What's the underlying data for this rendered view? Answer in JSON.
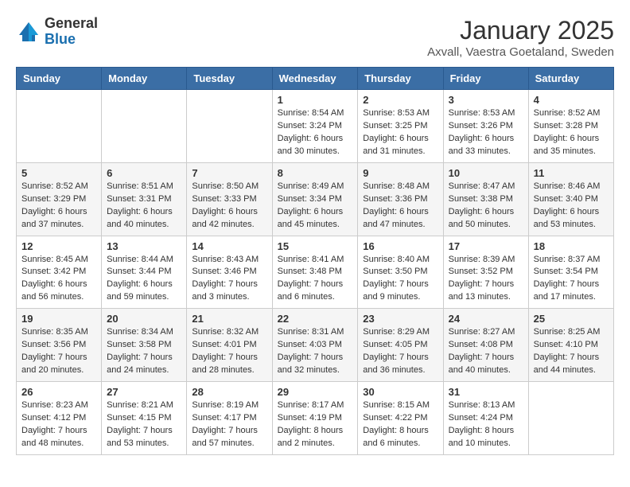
{
  "logo": {
    "general": "General",
    "blue": "Blue"
  },
  "title": "January 2025",
  "location": "Axvall, Vaestra Goetaland, Sweden",
  "days_of_week": [
    "Sunday",
    "Monday",
    "Tuesday",
    "Wednesday",
    "Thursday",
    "Friday",
    "Saturday"
  ],
  "weeks": [
    [
      {
        "day": "",
        "info": ""
      },
      {
        "day": "",
        "info": ""
      },
      {
        "day": "",
        "info": ""
      },
      {
        "day": "1",
        "info": "Sunrise: 8:54 AM\nSunset: 3:24 PM\nDaylight: 6 hours\nand 30 minutes."
      },
      {
        "day": "2",
        "info": "Sunrise: 8:53 AM\nSunset: 3:25 PM\nDaylight: 6 hours\nand 31 minutes."
      },
      {
        "day": "3",
        "info": "Sunrise: 8:53 AM\nSunset: 3:26 PM\nDaylight: 6 hours\nand 33 minutes."
      },
      {
        "day": "4",
        "info": "Sunrise: 8:52 AM\nSunset: 3:28 PM\nDaylight: 6 hours\nand 35 minutes."
      }
    ],
    [
      {
        "day": "5",
        "info": "Sunrise: 8:52 AM\nSunset: 3:29 PM\nDaylight: 6 hours\nand 37 minutes."
      },
      {
        "day": "6",
        "info": "Sunrise: 8:51 AM\nSunset: 3:31 PM\nDaylight: 6 hours\nand 40 minutes."
      },
      {
        "day": "7",
        "info": "Sunrise: 8:50 AM\nSunset: 3:33 PM\nDaylight: 6 hours\nand 42 minutes."
      },
      {
        "day": "8",
        "info": "Sunrise: 8:49 AM\nSunset: 3:34 PM\nDaylight: 6 hours\nand 45 minutes."
      },
      {
        "day": "9",
        "info": "Sunrise: 8:48 AM\nSunset: 3:36 PM\nDaylight: 6 hours\nand 47 minutes."
      },
      {
        "day": "10",
        "info": "Sunrise: 8:47 AM\nSunset: 3:38 PM\nDaylight: 6 hours\nand 50 minutes."
      },
      {
        "day": "11",
        "info": "Sunrise: 8:46 AM\nSunset: 3:40 PM\nDaylight: 6 hours\nand 53 minutes."
      }
    ],
    [
      {
        "day": "12",
        "info": "Sunrise: 8:45 AM\nSunset: 3:42 PM\nDaylight: 6 hours\nand 56 minutes."
      },
      {
        "day": "13",
        "info": "Sunrise: 8:44 AM\nSunset: 3:44 PM\nDaylight: 6 hours\nand 59 minutes."
      },
      {
        "day": "14",
        "info": "Sunrise: 8:43 AM\nSunset: 3:46 PM\nDaylight: 7 hours\nand 3 minutes."
      },
      {
        "day": "15",
        "info": "Sunrise: 8:41 AM\nSunset: 3:48 PM\nDaylight: 7 hours\nand 6 minutes."
      },
      {
        "day": "16",
        "info": "Sunrise: 8:40 AM\nSunset: 3:50 PM\nDaylight: 7 hours\nand 9 minutes."
      },
      {
        "day": "17",
        "info": "Sunrise: 8:39 AM\nSunset: 3:52 PM\nDaylight: 7 hours\nand 13 minutes."
      },
      {
        "day": "18",
        "info": "Sunrise: 8:37 AM\nSunset: 3:54 PM\nDaylight: 7 hours\nand 17 minutes."
      }
    ],
    [
      {
        "day": "19",
        "info": "Sunrise: 8:35 AM\nSunset: 3:56 PM\nDaylight: 7 hours\nand 20 minutes."
      },
      {
        "day": "20",
        "info": "Sunrise: 8:34 AM\nSunset: 3:58 PM\nDaylight: 7 hours\nand 24 minutes."
      },
      {
        "day": "21",
        "info": "Sunrise: 8:32 AM\nSunset: 4:01 PM\nDaylight: 7 hours\nand 28 minutes."
      },
      {
        "day": "22",
        "info": "Sunrise: 8:31 AM\nSunset: 4:03 PM\nDaylight: 7 hours\nand 32 minutes."
      },
      {
        "day": "23",
        "info": "Sunrise: 8:29 AM\nSunset: 4:05 PM\nDaylight: 7 hours\nand 36 minutes."
      },
      {
        "day": "24",
        "info": "Sunrise: 8:27 AM\nSunset: 4:08 PM\nDaylight: 7 hours\nand 40 minutes."
      },
      {
        "day": "25",
        "info": "Sunrise: 8:25 AM\nSunset: 4:10 PM\nDaylight: 7 hours\nand 44 minutes."
      }
    ],
    [
      {
        "day": "26",
        "info": "Sunrise: 8:23 AM\nSunset: 4:12 PM\nDaylight: 7 hours\nand 48 minutes."
      },
      {
        "day": "27",
        "info": "Sunrise: 8:21 AM\nSunset: 4:15 PM\nDaylight: 7 hours\nand 53 minutes."
      },
      {
        "day": "28",
        "info": "Sunrise: 8:19 AM\nSunset: 4:17 PM\nDaylight: 7 hours\nand 57 minutes."
      },
      {
        "day": "29",
        "info": "Sunrise: 8:17 AM\nSunset: 4:19 PM\nDaylight: 8 hours\nand 2 minutes."
      },
      {
        "day": "30",
        "info": "Sunrise: 8:15 AM\nSunset: 4:22 PM\nDaylight: 8 hours\nand 6 minutes."
      },
      {
        "day": "31",
        "info": "Sunrise: 8:13 AM\nSunset: 4:24 PM\nDaylight: 8 hours\nand 10 minutes."
      },
      {
        "day": "",
        "info": ""
      }
    ]
  ]
}
